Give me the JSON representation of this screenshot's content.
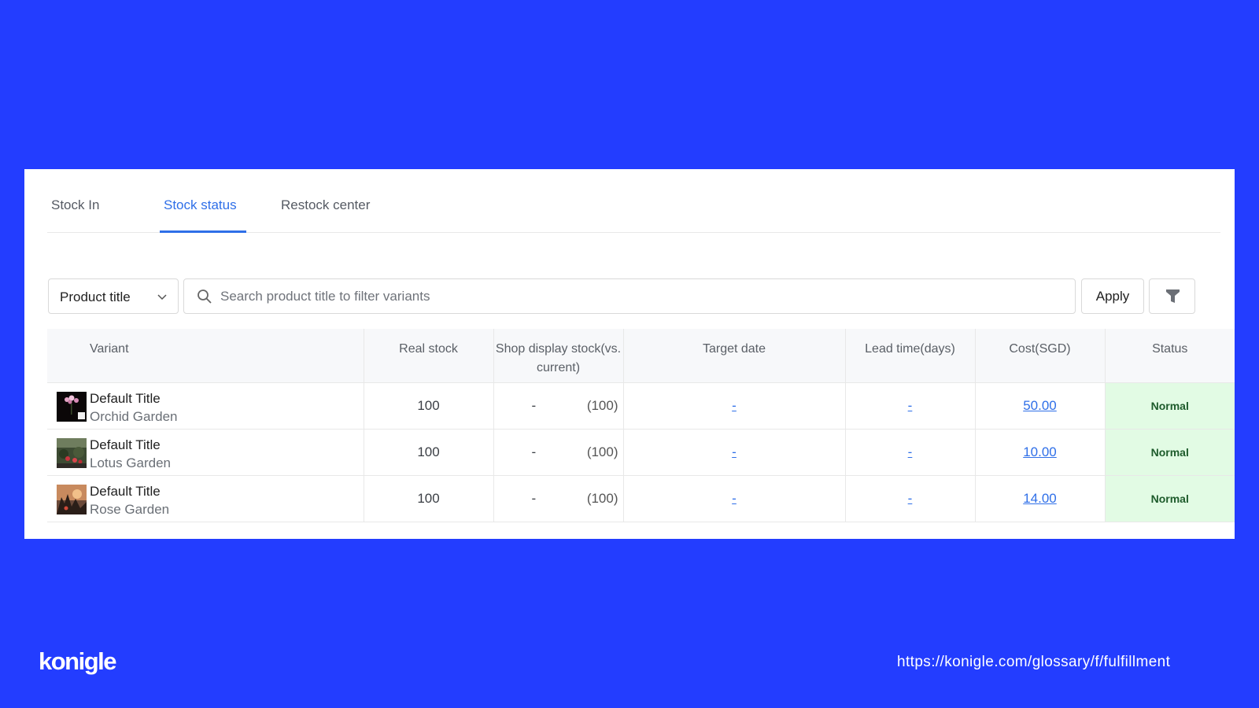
{
  "tabs": [
    {
      "label": "Stock In",
      "active": false
    },
    {
      "label": "Stock status",
      "active": true
    },
    {
      "label": "Restock center",
      "active": false
    }
  ],
  "filter": {
    "field_selected": "Product title",
    "search_placeholder": "Search product title to filter variants",
    "apply_label": "Apply"
  },
  "table": {
    "headers": {
      "variant": "Variant",
      "real_stock": "Real stock",
      "shop_display": "Shop display stock(vs. current)",
      "target_date": "Target date",
      "lead_time": "Lead time(days)",
      "cost": "Cost(SGD)",
      "status": "Status"
    },
    "rows": [
      {
        "title": "Default Title",
        "subtitle": "Orchid Garden",
        "real_stock": "100",
        "shop_display": "-",
        "vs_current": "(100)",
        "target_date": "-",
        "lead_time": "-",
        "cost": "50.00",
        "status": "Normal"
      },
      {
        "title": "Default Title",
        "subtitle": "Lotus Garden",
        "real_stock": "100",
        "shop_display": "-",
        "vs_current": "(100)",
        "target_date": "-",
        "lead_time": "-",
        "cost": "10.00",
        "status": "Normal"
      },
      {
        "title": "Default Title",
        "subtitle": "Rose Garden",
        "real_stock": "100",
        "shop_display": "-",
        "vs_current": "(100)",
        "target_date": "-",
        "lead_time": "-",
        "cost": "14.00",
        "status": "Normal"
      }
    ]
  },
  "colors": {
    "background": "#233dff",
    "accent": "#2f6fe8",
    "status_bg": "#e2fbe4"
  },
  "footer": {
    "logo": "konigle",
    "url": "https://konigle.com/glossary/f/fulfillment"
  }
}
